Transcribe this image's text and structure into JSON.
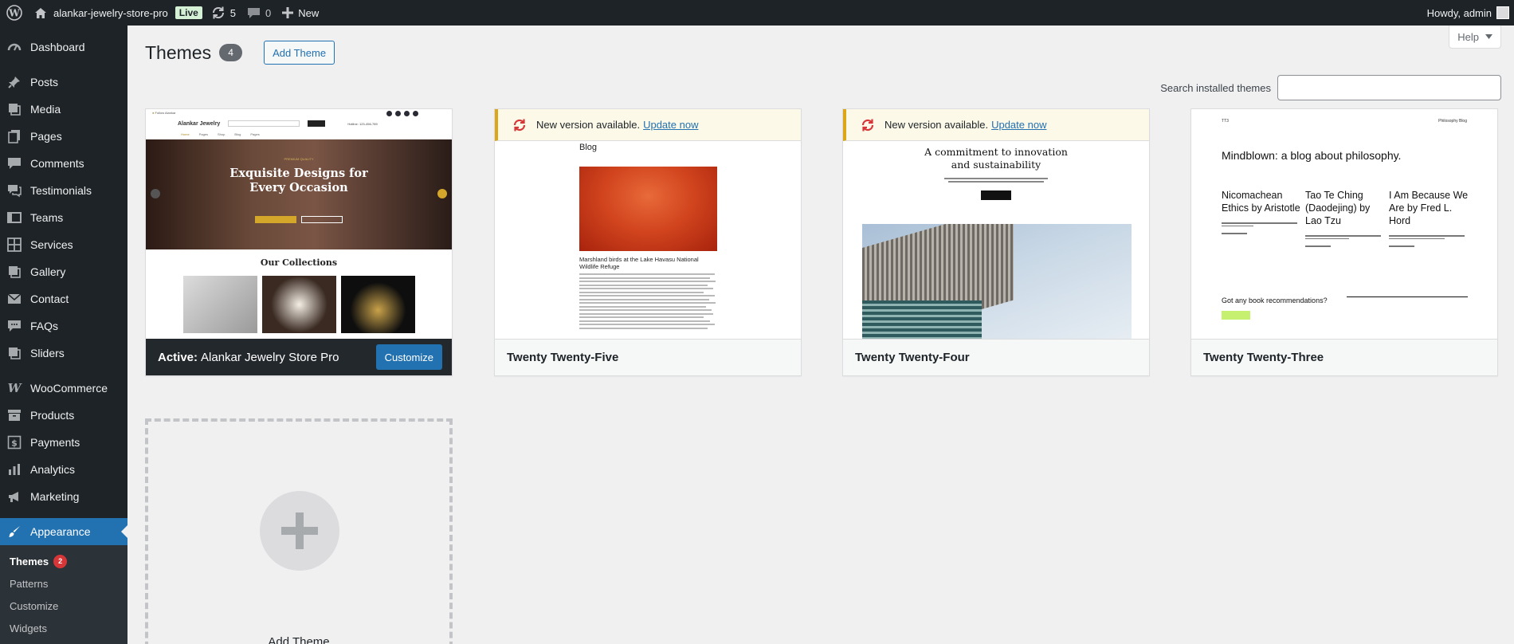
{
  "adminbar": {
    "site_name": "alankar-jewelry-store-pro",
    "live_label": "Live",
    "updates_count": "5",
    "comments_count": "0",
    "new_label": "New",
    "howdy": "Howdy, admin"
  },
  "sidebar": {
    "items": [
      {
        "label": "Dashboard",
        "icon": "dashboard-icon"
      },
      {
        "label": "Posts",
        "icon": "pin-icon"
      },
      {
        "label": "Media",
        "icon": "media-icon"
      },
      {
        "label": "Pages",
        "icon": "pages-icon"
      },
      {
        "label": "Comments",
        "icon": "comment-icon"
      },
      {
        "label": "Testimonials",
        "icon": "testimonial-icon"
      },
      {
        "label": "Teams",
        "icon": "teams-icon"
      },
      {
        "label": "Services",
        "icon": "grid-icon"
      },
      {
        "label": "Gallery",
        "icon": "gallery-icon"
      },
      {
        "label": "Contact",
        "icon": "mail-icon"
      },
      {
        "label": "FAQs",
        "icon": "faq-icon"
      },
      {
        "label": "Sliders",
        "icon": "slider-icon"
      },
      {
        "label": "WooCommerce",
        "icon": "woo-icon"
      },
      {
        "label": "Products",
        "icon": "archive-icon"
      },
      {
        "label": "Payments",
        "icon": "dollar-icon"
      },
      {
        "label": "Analytics",
        "icon": "bar-chart-icon"
      },
      {
        "label": "Marketing",
        "icon": "megaphone-icon"
      },
      {
        "label": "Appearance",
        "icon": "brush-icon"
      }
    ],
    "submenu": [
      {
        "label": "Themes",
        "badge": "2"
      },
      {
        "label": "Patterns"
      },
      {
        "label": "Customize"
      },
      {
        "label": "Widgets"
      }
    ]
  },
  "page": {
    "title": "Themes",
    "count": "4",
    "add_button": "Add Theme",
    "help_label": "Help",
    "search_label": "Search installed themes",
    "search_value": ""
  },
  "themes": [
    {
      "name": "Alankar Jewelry Store Pro",
      "active_prefix": "Active:",
      "customize_label": "Customize",
      "preview": {
        "logo": "Alankar Jewelry",
        "hero_heading_1": "Exquisite Designs for",
        "hero_heading_2": "Every Occasion",
        "collections": "Our Collections"
      }
    },
    {
      "name": "Twenty Twenty-Five",
      "notice": "New version available.",
      "notice_link": "Update now",
      "preview": {
        "heading": "Blog",
        "caption": "Marshland birds at the Lake Havasu National Wildlife Refuge"
      }
    },
    {
      "name": "Twenty Twenty-Four",
      "notice": "New version available.",
      "notice_link": "Update now",
      "preview": {
        "headline_1": "A commitment to innovation",
        "headline_2": "and sustainability"
      }
    },
    {
      "name": "Twenty Twenty-Three",
      "preview": {
        "site": "TT3",
        "nav": "Philosophy   Blog",
        "heading": "Mindblown: a blog about philosophy.",
        "posts": [
          "Nicomachean Ethics by Aristotle",
          "Tao Te Ching (Daodejing) by Lao Tzu",
          "I Am Because We Are by Fred L. Hord"
        ],
        "cta": "Got any book recommendations?"
      }
    }
  ],
  "add_theme_card": {
    "label": "Add Theme"
  },
  "colors": {
    "accent": "#2271b1",
    "adminbar": "#1d2327",
    "badge": "#d63638"
  }
}
